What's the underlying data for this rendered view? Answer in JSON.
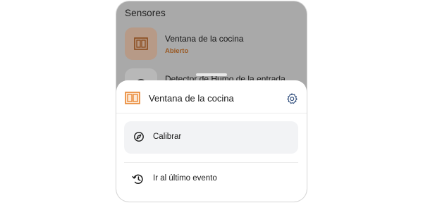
{
  "sensors_section": {
    "title": "Sensores",
    "items": [
      {
        "name": "Ventana de la cocina",
        "status": "Abierto",
        "icon": "window-icon"
      },
      {
        "name": "Detector de Humo de la entrada",
        "status": "",
        "icon": "smoke-detector-icon"
      }
    ]
  },
  "sheet": {
    "title": "Ventana de la cocina",
    "header_icon": "window-icon",
    "settings_icon": "gear-icon",
    "actions": [
      {
        "label": "Calibrar",
        "icon": "compass-icon"
      },
      {
        "label": "Ir al último evento",
        "icon": "history-icon"
      }
    ]
  },
  "colors": {
    "accent_orange": "#e8832c",
    "status_orange": "#9a5a24",
    "overlay_gray": "#a9a9a9",
    "button_bg": "#f2f3f5"
  }
}
